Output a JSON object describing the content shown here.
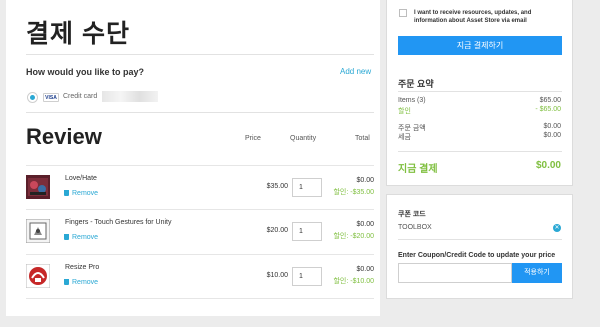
{
  "page": {
    "title": "결제 수단"
  },
  "payment": {
    "question": "How would you like to pay?",
    "add_new": "Add new",
    "card_brand": "VISA",
    "card_label": "Credit card"
  },
  "review": {
    "title": "Review",
    "columns": {
      "price": "Price",
      "quantity": "Quantity",
      "total": "Total"
    },
    "remove_label": "Remove",
    "items": [
      {
        "name": "Love/Hate",
        "price": "$35.00",
        "quantity": "1",
        "total": "$0.00",
        "discount": "할인: -$35.00"
      },
      {
        "name": "Fingers - Touch Gestures for Unity",
        "price": "$20.00",
        "quantity": "1",
        "total": "$0.00",
        "discount": "할인: -$20.00"
      },
      {
        "name": "Resize Pro",
        "price": "$10.00",
        "quantity": "1",
        "total": "$0.00",
        "discount": "할인: -$10.00"
      }
    ]
  },
  "checkout": {
    "consent_text": "I want to receive resources, updates, and information about Asset Store via email",
    "pay_button": "지금 결제하기"
  },
  "summary": {
    "title": "주문 요약",
    "items_label": "Items (3)",
    "items_value": "$65.00",
    "discount_label": "할인",
    "discount_value": "- $65.00",
    "order_amount_label": "주문 금액",
    "order_amount_value": "$0.00",
    "tax_label": "세금",
    "tax_value": "$0.00",
    "grand_label": "지금 결제",
    "grand_value": "$0.00"
  },
  "coupon": {
    "title": "쿠폰 코드",
    "code": "TOOLBOX",
    "prompt": "Enter Coupon/Credit Code to update your price",
    "input_value": "",
    "apply_button": "적용하기"
  },
  "colors": {
    "accent_blue": "#2196f3",
    "link_blue": "#2aa8d4",
    "discount_green": "#7fbf3f"
  }
}
